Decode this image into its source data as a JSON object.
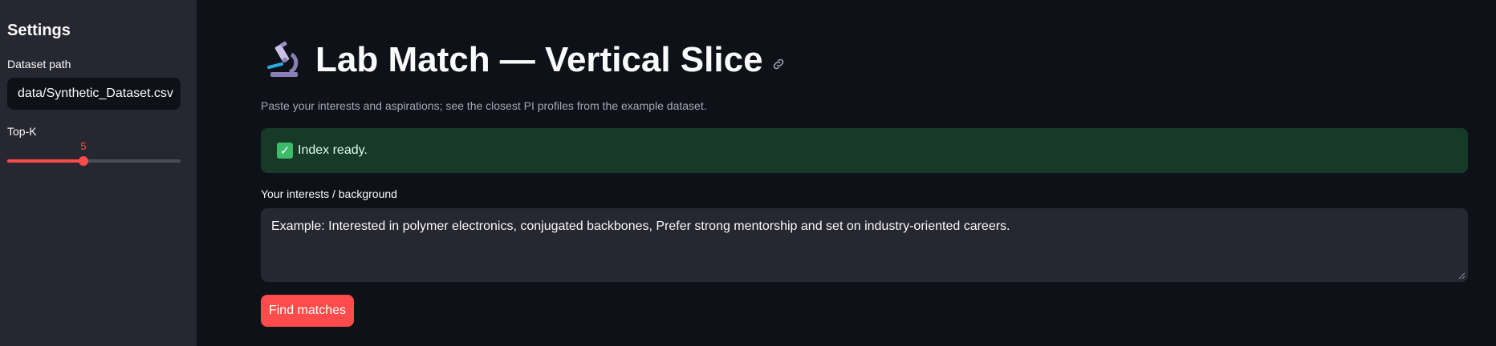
{
  "sidebar": {
    "title": "Settings",
    "dataset_path": {
      "label": "Dataset path",
      "value": "data/Synthetic_Dataset.csv"
    },
    "top_k": {
      "label": "Top-K",
      "value": "5",
      "fraction": 0.44
    }
  },
  "main": {
    "title": "Lab Match — Vertical Slice",
    "title_icon": "microscope-icon",
    "caption": "Paste your interests and aspirations; see the closest PI profiles from the example dataset.",
    "alert": {
      "icon": "check-icon",
      "text": "Index ready."
    },
    "interests": {
      "label": "Your interests / background",
      "placeholder": "Example: Interested in polymer electronics, conjugated backbones, Prefer strong mentorship and set on industry-oriented careers."
    },
    "find_button": "Find matches"
  },
  "colors": {
    "background": "#0e1117",
    "sidebar": "#262730",
    "accent": "#ff4b4b",
    "success_bg": "#173928"
  }
}
